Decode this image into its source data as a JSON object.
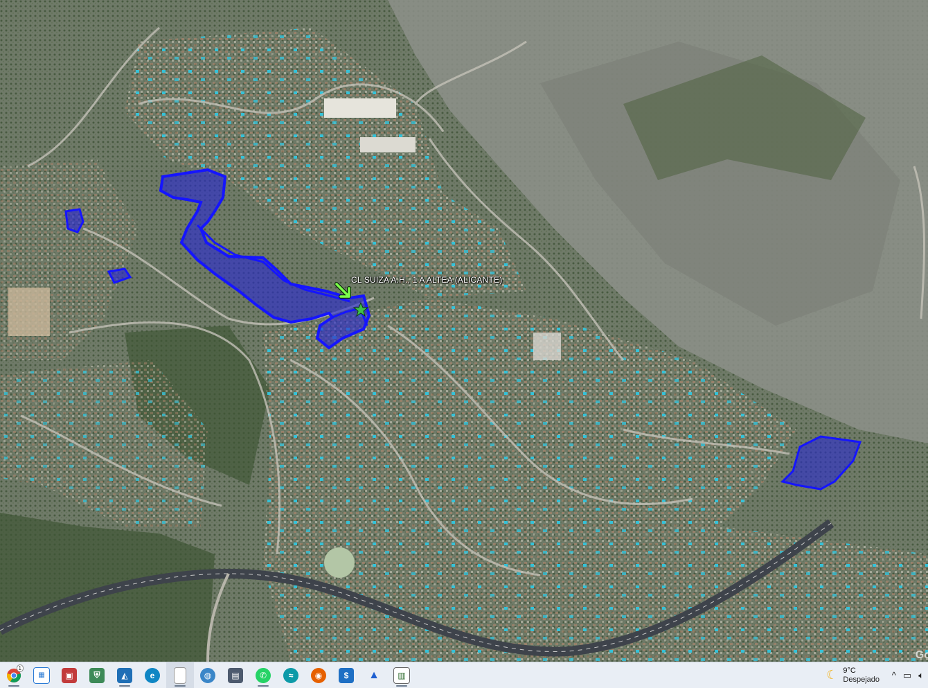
{
  "map": {
    "placemark_label": "CL SUIZA A.H., 1 A ALTEA (ALICANTE)",
    "watermark": "Go",
    "colors": {
      "terrain": "#6f7a68",
      "mountain": "#8d9189",
      "forest": "#44573a",
      "road": "#4a4f58",
      "parcel_fill": "#2a2ad0",
      "parcel_stroke": "#1515ff",
      "arrow": "#7cff4a",
      "star": "#3fbf4a"
    }
  },
  "taskbar": {
    "apps": [
      {
        "name": "chrome-icon",
        "badge": "1"
      },
      {
        "name": "sheets-icon"
      },
      {
        "name": "camera-icon"
      },
      {
        "name": "lock-window-icon"
      },
      {
        "name": "photos-icon"
      },
      {
        "name": "edge-icon"
      },
      {
        "name": "document-icon"
      },
      {
        "name": "globe-icon"
      },
      {
        "name": "save-disk-icon"
      },
      {
        "name": "whatsapp-icon"
      },
      {
        "name": "wave-app-icon"
      },
      {
        "name": "firefox-icon"
      },
      {
        "name": "dollar-app-icon"
      },
      {
        "name": "arc-app-icon"
      },
      {
        "name": "window-app-icon"
      }
    ],
    "weather": {
      "temp": "9°C",
      "condition": "Despejado",
      "icon": "moon-icon"
    },
    "tray": {
      "chevron": "^",
      "icons": [
        "network-icon",
        "volume-icon"
      ]
    }
  }
}
